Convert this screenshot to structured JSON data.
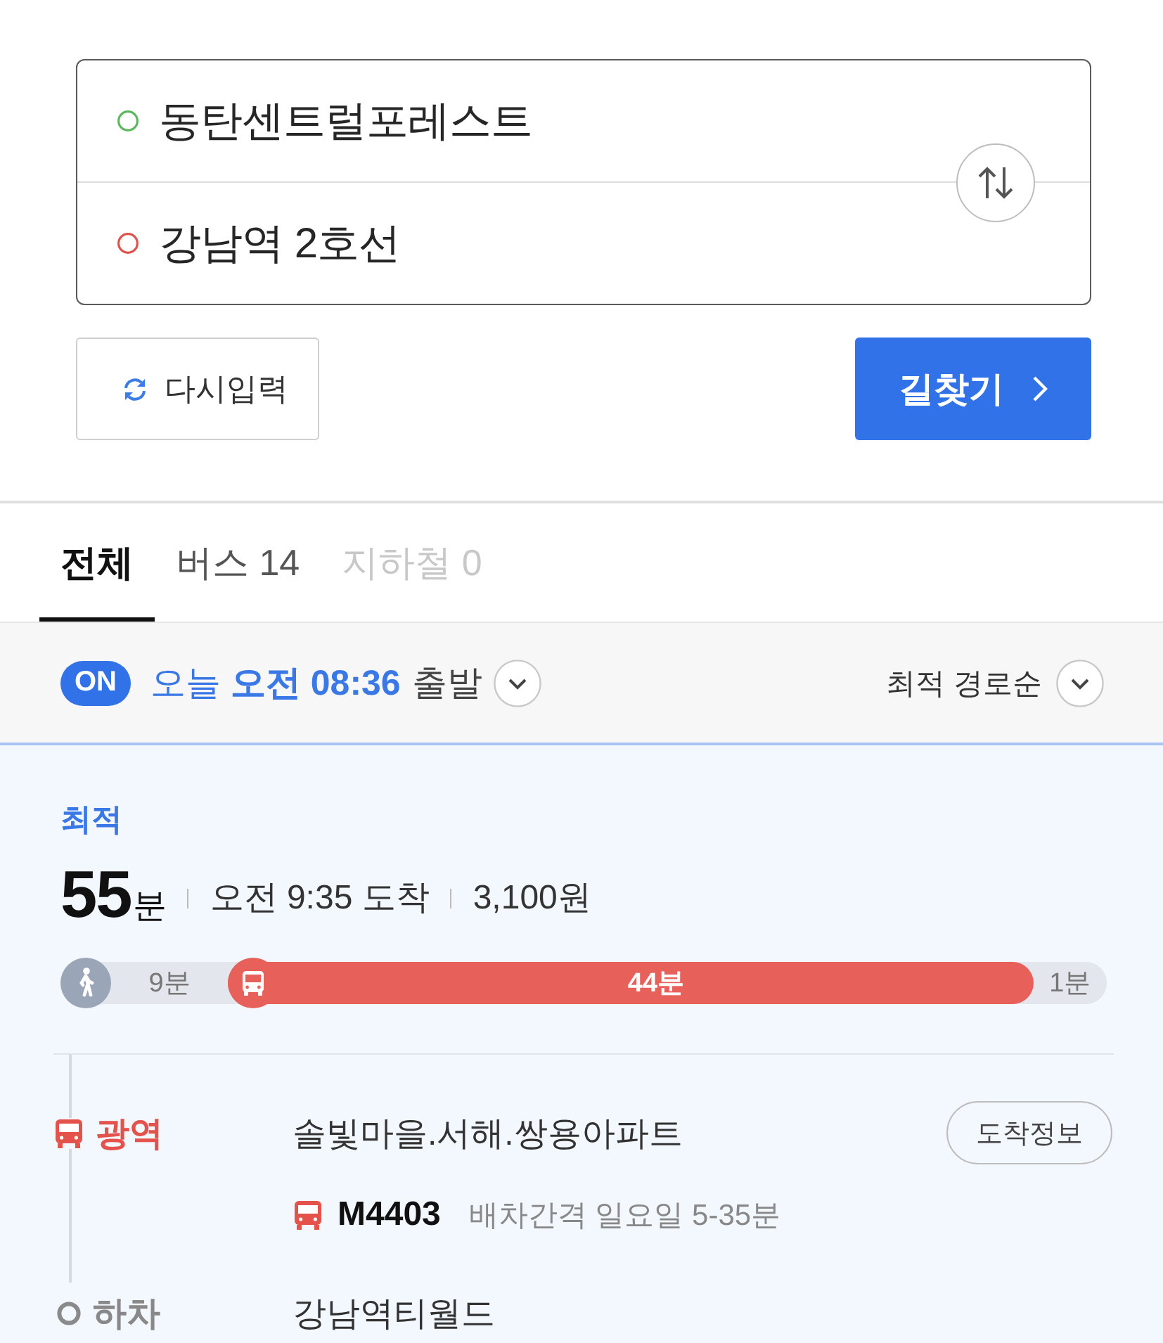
{
  "route_input": {
    "stops": [
      {
        "kind": "origin",
        "value": "동탄센트럴포레스트"
      },
      {
        "kind": "destination",
        "value": "강남역 2호선"
      }
    ]
  },
  "actions": {
    "reset_button": "다시입력",
    "search_button": "길찾기"
  },
  "tabs": [
    {
      "label": "전체",
      "selected": true,
      "disabled": false
    },
    {
      "label": "버스 14",
      "selected": false,
      "disabled": false
    },
    {
      "label": "지하철 0",
      "selected": false,
      "disabled": true
    }
  ],
  "filter_bar": {
    "realtime_toggle": {
      "label": "ON",
      "on": true
    },
    "departure": {
      "time": "오늘 **오전 08:36**",
      "suffix": "출발"
    },
    "sort": {
      "label": "최적 경로순"
    }
  },
  "route": {
    "badge": "최적",
    "duration": {
      "number": "55",
      "unit": "분"
    },
    "arrival": "오전 9:35 도착",
    "fare": "3,100원",
    "timeline": [
      {
        "kind": "walk",
        "label": "9분",
        "level": 0.16,
        "icon": true
      },
      {
        "kind": "bus",
        "label": "44분",
        "icon": true
      },
      {
        "kind": "walk",
        "label": "1분",
        "level": 0.07,
        "icon": false
      }
    ],
    "steps": [
      {
        "kind": "board",
        "mode": "광역",
        "stop": "솔빛마을.서해.쌍용아파트",
        "button": "도착정보",
        "bus_number": "M4403",
        "interval": "배차간격 일요일 5-35분"
      },
      {
        "kind": "alight",
        "mode": "하차",
        "stop": "강남역티월드"
      }
    ]
  }
}
